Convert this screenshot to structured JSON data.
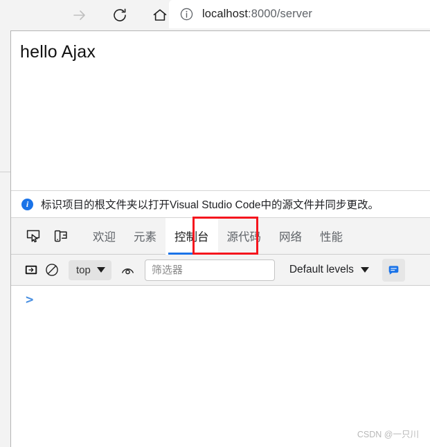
{
  "browser": {
    "nav": [
      {
        "name": "forward-button",
        "icon": "arrow-right-icon",
        "state": "disabled"
      },
      {
        "name": "reload-button",
        "icon": "reload-icon",
        "state": "enabled"
      },
      {
        "name": "home-button",
        "icon": "home-icon",
        "state": "enabled"
      }
    ],
    "omnibox": {
      "info_icon": "info-circle-icon",
      "host": "localhost",
      "path": ":8000/server",
      "full_url": "localhost:8000/server"
    }
  },
  "page": {
    "heading": "hello Ajax"
  },
  "infobar": {
    "icon": "info-circle-filled-icon",
    "icon_glyph": "i",
    "message": "标识项目的根文件夹以打开Visual Studio Code中的源文件并同步更改。",
    "accent_color": "#1a73e8"
  },
  "devtools": {
    "tool_icons": [
      {
        "name": "inspect-element-icon",
        "title": "检查元素"
      },
      {
        "name": "device-toolbar-icon",
        "title": "设备工具栏"
      }
    ],
    "tabs": [
      {
        "label": "欢迎",
        "active": false
      },
      {
        "label": "元素",
        "active": false
      },
      {
        "label": "控制台",
        "active": true
      },
      {
        "label": "源代码",
        "active": false
      },
      {
        "label": "网络",
        "active": false
      },
      {
        "label": "性能",
        "active": false
      }
    ],
    "active_tab": "控制台",
    "annotation": {
      "type": "red-rectangle",
      "color": "#f5151d",
      "target": "控制台"
    },
    "console_toolbar": {
      "sidebar_toggle_icon": "console-sidebar-icon",
      "clear_icon": "clear-console-icon",
      "context_selector": {
        "value": "top",
        "caret": "chevron-down-icon"
      },
      "eye_icon": "live-expression-icon",
      "filter": {
        "value": "",
        "placeholder": "筛选器"
      },
      "levels": {
        "label": "Default levels",
        "caret": "chevron-down-icon"
      },
      "issues_icon": "issues-message-icon",
      "issues_icon_color": "#1a73e8"
    },
    "console_body": {
      "prompt": ">",
      "prompt_color": "#4a90e2",
      "entries": []
    }
  },
  "watermark": {
    "text": "CSDN @一只川"
  }
}
